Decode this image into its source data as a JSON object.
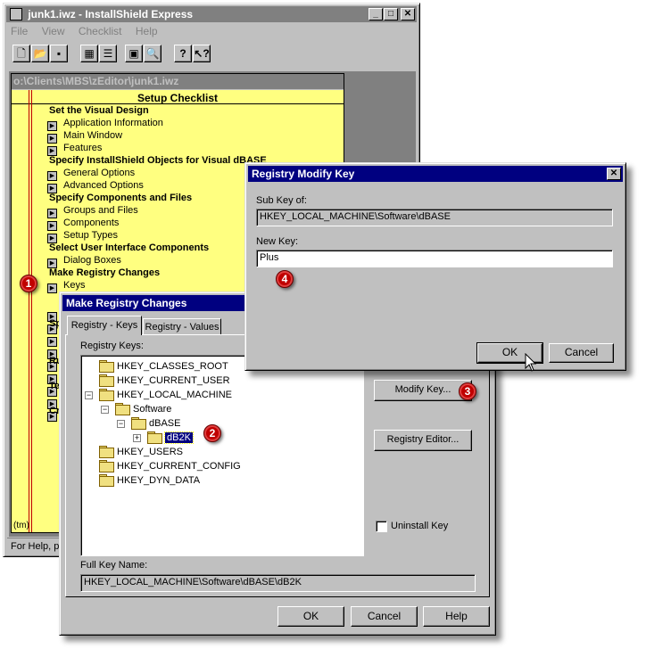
{
  "main_window": {
    "title": "junk1.iwz - InstallShield Express",
    "menu": [
      "File",
      "View",
      "Checklist",
      "Help"
    ],
    "path_bar": "o:\\Clients\\MBS\\zEditor\\junk1.iwz",
    "checklist_title": "Setup Checklist",
    "checklist": [
      {
        "type": "head",
        "text": "Set the Visual Design"
      },
      {
        "type": "item",
        "text": "Application Information"
      },
      {
        "type": "item",
        "text": "Main Window"
      },
      {
        "type": "item",
        "text": "Features"
      },
      {
        "type": "head",
        "text": "Specify InstallShield Objects for Visual dBASE"
      },
      {
        "type": "item",
        "text": "General Options"
      },
      {
        "type": "item",
        "text": "Advanced Options"
      },
      {
        "type": "head",
        "text": "Specify Components and Files"
      },
      {
        "type": "item",
        "text": "Groups and Files"
      },
      {
        "type": "item",
        "text": "Components"
      },
      {
        "type": "item",
        "text": "Setup Types"
      },
      {
        "type": "head",
        "text": "Select User Interface Components"
      },
      {
        "type": "item",
        "text": "Dialog Boxes"
      },
      {
        "type": "head",
        "text": "Make Registry Changes"
      },
      {
        "type": "item",
        "text": "Keys"
      }
    ],
    "partial_labels": [
      "Sp",
      "Ru",
      "Te",
      "Cr"
    ],
    "tm": "(tm)",
    "status": "For Help, pr"
  },
  "registry_dialog": {
    "title": "Make Registry Changes",
    "tabs": [
      "Registry - Keys",
      "Registry - Values"
    ],
    "keys_label": "Registry Keys:",
    "tree": [
      {
        "label": "HKEY_CLASSES_ROOT",
        "level": 0,
        "expander": ""
      },
      {
        "label": "HKEY_CURRENT_USER",
        "level": 0,
        "expander": ""
      },
      {
        "label": "HKEY_LOCAL_MACHINE",
        "level": 0,
        "expander": "-"
      },
      {
        "label": "Software",
        "level": 1,
        "expander": "-"
      },
      {
        "label": "dBASE",
        "level": 2,
        "expander": "-"
      },
      {
        "label": "dB2K",
        "level": 3,
        "expander": "+",
        "selected": true
      },
      {
        "label": "HKEY_USERS",
        "level": 0,
        "expander": ""
      },
      {
        "label": "HKEY_CURRENT_CONFIG",
        "level": 0,
        "expander": ""
      },
      {
        "label": "HKEY_DYN_DATA",
        "level": 0,
        "expander": ""
      }
    ],
    "modify_key": "Modify Key...",
    "registry_editor": "Registry Editor...",
    "uninstall_key": "Uninstall Key",
    "full_key_label": "Full Key Name:",
    "full_key_value": "HKEY_LOCAL_MACHINE\\Software\\dBASE\\dB2K",
    "ok": "OK",
    "cancel": "Cancel",
    "help": "Help"
  },
  "modify_dialog": {
    "title": "Registry Modify Key",
    "subkey_label": "Sub Key of:",
    "subkey_value": "HKEY_LOCAL_MACHINE\\Software\\dBASE",
    "newkey_label": "New Key:",
    "newkey_value": "Plus",
    "ok": "OK",
    "cancel": "Cancel"
  },
  "callouts": [
    "1",
    "2",
    "3",
    "4"
  ],
  "colors": {
    "checklist_bg": "#ffff80",
    "title_active": "#000080",
    "callout": "#c00000",
    "red_line": "#c00000"
  }
}
